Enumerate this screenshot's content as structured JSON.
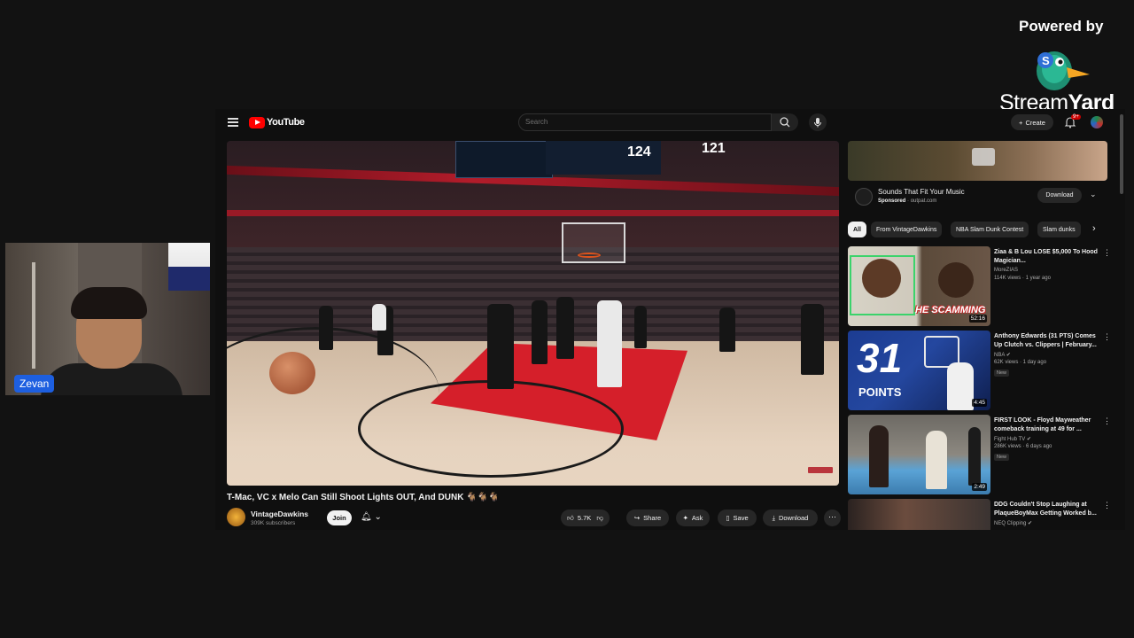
{
  "branding": {
    "powered_by": "Powered by",
    "product_name_a": "Stream",
    "product_name_b": "Yard"
  },
  "webcam": {
    "participant_name": "Zevan"
  },
  "youtube": {
    "logo_text": "YouTube",
    "search_placeholder": "Search",
    "create_label": "Create",
    "notification_badge": "9+",
    "video": {
      "title": "T-Mac, VC x Melo Can Still Shoot Lights OUT, And DUNK 🐐🐐🐐",
      "channel_name": "VintageDawkins",
      "subscribers": "309K subscribers",
      "join_label": "Join",
      "like_count": "5.7K",
      "share_label": "Share",
      "ask_label": "Ask",
      "save_label": "Save",
      "download_label": "Download",
      "scoreboard_a": "124",
      "scoreboard_b": "121"
    },
    "ad": {
      "title": "Sounds That Fit Your Music",
      "sponsored_label": "Sponsored",
      "domain": "outpat.com",
      "cta": "Download"
    },
    "chips": [
      "All",
      "From VintageDawkins",
      "NBA Slam Dunk Contest",
      "Slam dunks"
    ],
    "recommendations": [
      {
        "title": "Ziaa & B Lou LOSE $5,000 To Hood Magician...",
        "channel": "MoreZIAS",
        "meta": "114K views · 1 year ago",
        "duration": "52:16",
        "thumb_caption": "HE SCAMMING",
        "badge": ""
      },
      {
        "title": "Anthony Edwards (31 PTS) Comes Up Clutch vs. Clippers | February...",
        "channel": "NBA",
        "meta": "62K views · 1 day ago",
        "duration": "4:45",
        "thumb_caption": "31",
        "thumb_caption_2": "POINTS",
        "badge": "New"
      },
      {
        "title": "FIRST LOOK - Floyd Mayweather comeback training at 49 for ...",
        "channel": "Fight Hub TV",
        "meta": "286K views · 6 days ago",
        "duration": "2:49",
        "badge": "New"
      },
      {
        "title": "DDG Couldn't Stop Laughing at PlaqueBoyMax Getting Worked b...",
        "channel": "NEQ Clipping",
        "meta": "",
        "duration": "",
        "badge": ""
      }
    ]
  }
}
